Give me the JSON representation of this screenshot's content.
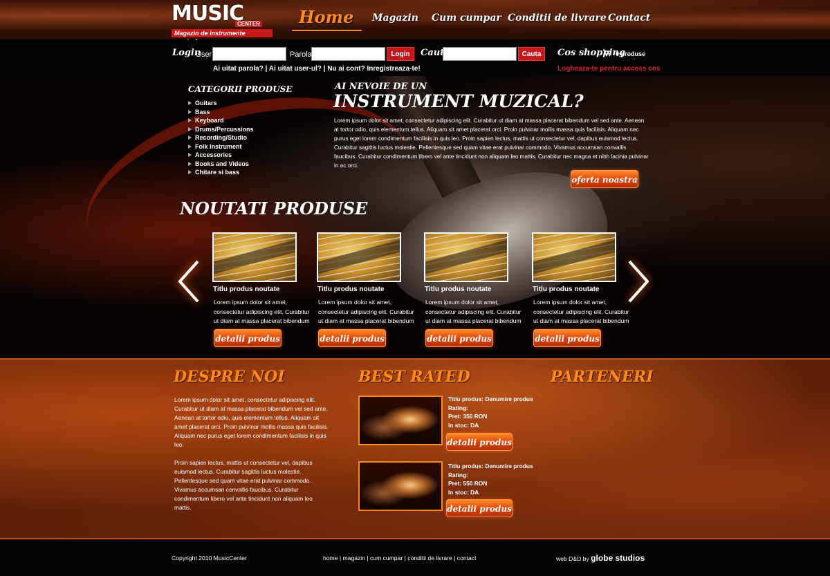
{
  "logo": {
    "word": "MUSIC",
    "sub": "CENTER",
    "tagline": "Magazin de instrumente muzicale"
  },
  "nav": {
    "items": [
      "Home",
      "Magazin",
      "Cum cumpar",
      "Conditii de livrare",
      "Contact"
    ]
  },
  "login": {
    "label": "Login",
    "user_label": "User:",
    "pass_label": "Parola:",
    "button": "Login",
    "search_label": "Cauta",
    "search_button": "Cauta",
    "links": "Ai uitat parola? | Ai uitat user-ul? | Nu ai cont? Inregistreaza-te!",
    "cart_label": "Cos shopping",
    "cart_count": "0 produse",
    "cart_notice": "Logheaza-te pentru access cos"
  },
  "categories": {
    "title": "CATEGORII PRODUSE",
    "items": [
      "Guitars",
      "Bass",
      "Keyboard",
      "Drums/Percussions",
      "Recording/Studio",
      "Folk Instrument",
      "Accessories",
      "Books and Videos",
      "Chitare si bass"
    ]
  },
  "intro": {
    "kicker": "AI NEVOIE DE UN",
    "title": "INSTRUMENT MUZICAL?",
    "text": "Lorem ipsum dolor sit amet, consectetur adipiscing elit. Curabitur ut diam at massa placerat bibendum vel sed ante. Aenean at tortor odio, quis elementum tellus. Aliquam sit amet placerat orci. Proin pulvinar mollis massa quis facilisis. Aliquam nec purus eget lorem condimentum facilisis in quis leo. Proin sapien lectus, mattis ut consectetur vel, dapibus euismod lectus. Curabitur sagittis luctus molestie. Pellentesque sed quam vitae erat pulvinar commodo. Vivamus accumsan convallis faucibus. Curabitur condimentum libero vel ante tincidunt non aliquam leo mattis. Curabitur nec magna et nibh lacinia pulvinar in ac orci.",
    "button": "oferta noastra"
  },
  "news": {
    "title": "NOUTATI PRODUSE",
    "products": [
      {
        "title": "Titlu produs noutate",
        "desc": "Lorem ipsum dolor sit amet, consectetur adipiscing elit. Curabitur ut diam at massa placerat bibendum",
        "button": "detalii produs"
      },
      {
        "title": "Titlu produs noutate",
        "desc": "Lorem ipsum dolor sit amet, consectetur adipiscing elit. Curabitur ut diam at massa placerat bibendum",
        "button": "detalii produs"
      },
      {
        "title": "Titlu produs noutate",
        "desc": "Lorem ipsum dolor sit amet, consectetur adipiscing elit. Curabitur ut diam at massa placerat bibendum",
        "button": "detalii produs"
      },
      {
        "title": "Titlu produs noutate",
        "desc": "Lorem ipsum dolor sit amet, consectetur adipiscing elit. Curabitur ut diam at massa placerat bibendum",
        "button": "detalii produs"
      }
    ]
  },
  "about": {
    "title": "DESPRE NOI",
    "p1": "Lorem ipsum dolor sit amet, consectetur adipiscing elit. Curabitur ut diam at massa placerat bibendum vel sed ante. Aenean at tortor odio, quis elementum tellus. Aliquam sit amet placerat orci. Proin pulvinar mollis massa quis facilisis. Aliquam nec purus eget lorem condimentum facilisis in quis leo.",
    "p2": "Proin sapien lectus, mattis ut consectetur vel, dapibus euismod lectus. Curabitur sagittis luctus molestie. Pellentesque sed quam vitae erat pulvinar commodo. Vivamus accumsan convallis faucibus. Curabitur condimentum libero vel ante tincidunt non aliquam leo mattis."
  },
  "rated": {
    "title": "BEST RATED",
    "items": [
      {
        "name": "Titlu produs: Denumire produs",
        "rating": "Rating:",
        "price": "Pret: 350 RON",
        "stock": "In stoc: DA",
        "button": "detalii produs"
      },
      {
        "name": "Titlu produs: Denumire produs",
        "rating": "Rating:",
        "price": "Pret: 550 RON",
        "stock": "In stoc: DA",
        "button": "detalii produs"
      }
    ]
  },
  "partners": {
    "title": "PARTENERI"
  },
  "footer": {
    "copyright": "Copyright 2010 MusicCenter",
    "links": "home | magazin | cum cumpar | conditii de livrare | contact",
    "credit": "web D&D by",
    "studio": "globe studios"
  },
  "colors": {
    "accent": "#ff8a1a",
    "button_red": "#c21818",
    "notice_red": "#d8202a"
  }
}
